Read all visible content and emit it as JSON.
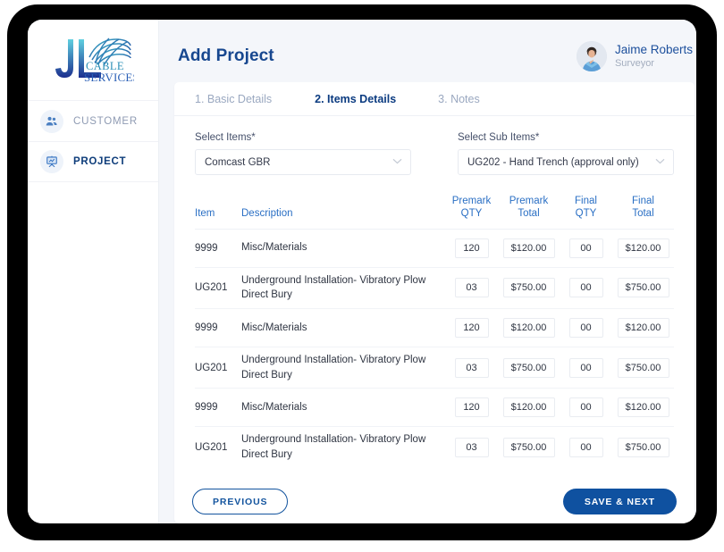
{
  "brand": {
    "logo_line1": "JL",
    "logo_line2": "CABLE",
    "logo_line3": "SERVICES",
    "accent": "#17478f",
    "accent_light": "#3fb5c9"
  },
  "sidebar": {
    "items": [
      {
        "label": "CUSTOMER",
        "icon": "users-icon",
        "active": false
      },
      {
        "label": "PROJECT",
        "icon": "presentation-board-icon",
        "active": true
      }
    ]
  },
  "header": {
    "title": "Add Project",
    "user": {
      "name": "Jaime Roberts",
      "role": "Surveyor"
    }
  },
  "tabs": [
    {
      "label": "1. Basic Details",
      "active": false
    },
    {
      "label": "2. Items Details",
      "active": true
    },
    {
      "label": "3. Notes",
      "active": false
    }
  ],
  "filters": {
    "items": {
      "label": "Select Items*",
      "value": "Comcast GBR"
    },
    "sub_items": {
      "label": "Select Sub Items*",
      "value": "UG202 - Hand Trench (approval only)"
    }
  },
  "table": {
    "headers": {
      "item": "Item",
      "description": "Description",
      "premark_qty_l1": "Premark",
      "premark_qty_l2": "QTY",
      "premark_total_l1": "Premark",
      "premark_total_l2": "Total",
      "final_qty_l1": "Final",
      "final_qty_l2": "QTY",
      "final_total_l1": "Final",
      "final_total_l2": "Total"
    },
    "rows": [
      {
        "item": "9999",
        "description": "Misc/Materials",
        "premark_qty": "120",
        "premark_total": "$120.00",
        "final_qty": "00",
        "final_total": "$120.00"
      },
      {
        "item": "UG201",
        "description": "Underground Installation- Vibratory Plow Direct Bury",
        "premark_qty": "03",
        "premark_total": "$750.00",
        "final_qty": "00",
        "final_total": "$750.00"
      },
      {
        "item": "9999",
        "description": "Misc/Materials",
        "premark_qty": "120",
        "premark_total": "$120.00",
        "final_qty": "00",
        "final_total": "$120.00"
      },
      {
        "item": "UG201",
        "description": "Underground Installation- Vibratory Plow Direct Bury",
        "premark_qty": "03",
        "premark_total": "$750.00",
        "final_qty": "00",
        "final_total": "$750.00"
      },
      {
        "item": "9999",
        "description": "Misc/Materials",
        "premark_qty": "120",
        "premark_total": "$120.00",
        "final_qty": "00",
        "final_total": "$120.00"
      },
      {
        "item": "UG201",
        "description": "Underground Installation- Vibratory Plow Direct Bury",
        "premark_qty": "03",
        "premark_total": "$750.00",
        "final_qty": "00",
        "final_total": "$750.00"
      }
    ]
  },
  "footer": {
    "previous": "PREVIOUS",
    "save_next": "SAVE & NEXT",
    "previous_color": "#13549e",
    "save_next_color": "#0f51a0"
  }
}
